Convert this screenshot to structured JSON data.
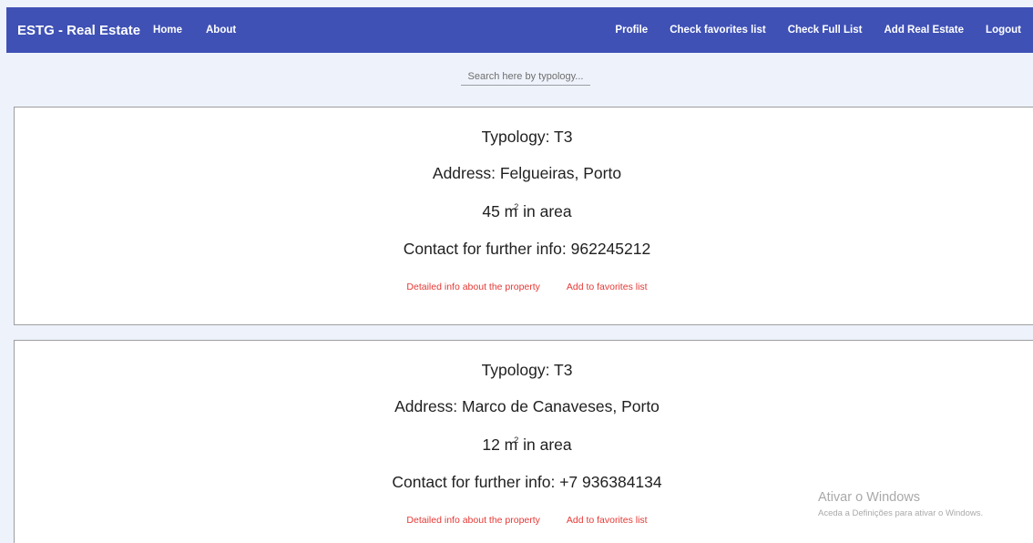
{
  "navbar": {
    "brand": "ESTG - Real Estate",
    "left_links": [
      "Home",
      "About"
    ],
    "right_links": [
      "Profile",
      "Check favorites list",
      "Check Full List",
      "Add Real Estate",
      "Logout"
    ],
    "color": "#3f51b5"
  },
  "search": {
    "placeholder": "Search here by typology..."
  },
  "properties": [
    {
      "typology": "Typology: T3",
      "address": "Address: Felgueiras, Porto",
      "area_number": "45 m",
      "area_sup": "2",
      "area_suffix": "in area",
      "contact": "Contact for further info: 962245212",
      "detail_link": "Detailed info about the property",
      "favorite_link": "Add to favorites list"
    },
    {
      "typology": "Typology: T3",
      "address": "Address: Marco de Canaveses, Porto",
      "area_number": "12 m",
      "area_sup": "2",
      "area_suffix": "in area",
      "contact": "Contact for further info: +7 936384134",
      "detail_link": "Detailed info about the property",
      "favorite_link": "Add to favorites list"
    }
  ],
  "watermark": {
    "title": "Ativar o Windows",
    "subtitle": "Aceda a Definições para ativar o Windows."
  },
  "colors": {
    "link": "#e53935",
    "background": "#eef2fb"
  }
}
